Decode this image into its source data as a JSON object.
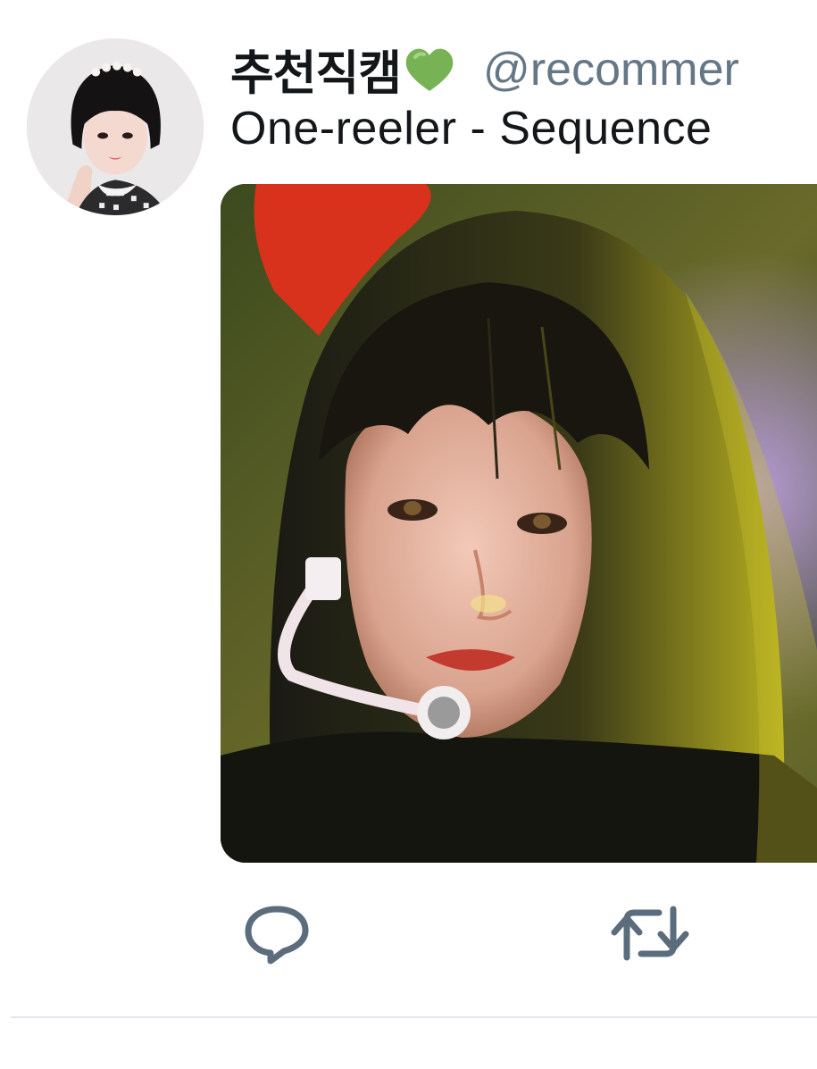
{
  "tweet": {
    "display_name": "추천직캠",
    "handle": "@recommer",
    "text": "One-reeler - Sequence",
    "heart_color": "#77b255"
  },
  "actions": {
    "reply_icon": "reply-icon",
    "retweet_icon": "retweet-icon",
    "icon_color": "#5b6d7d"
  },
  "colors": {
    "name": "#14171a",
    "handle": "#657786",
    "divider": "#e1e8ed"
  }
}
